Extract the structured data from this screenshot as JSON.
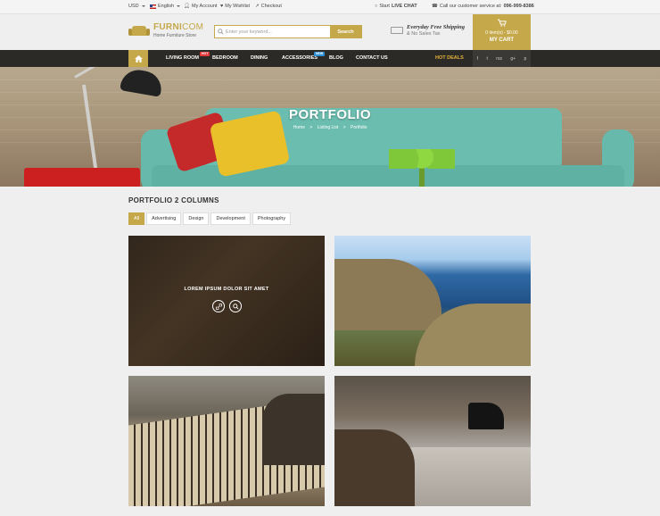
{
  "topbar": {
    "currency": "USD",
    "language": "English",
    "my_account": "My Account",
    "my_wishlist": "My Wishlist",
    "checkout": "Checkout",
    "live_chat_prefix": "Start",
    "live_chat": "LIVE CHAT",
    "call_prefix": "Call our customer service at:",
    "call_number": "096-999-8386"
  },
  "header": {
    "logo_name_a": "FURNI",
    "logo_name_b": "COM",
    "logo_sub": "Home Furniture Store",
    "search_placeholder": "Enter your keyword...",
    "search_button": "Search",
    "shipping_title": "Everyday Free Shipping",
    "shipping_sub": "& No Sales Tax",
    "cart_items": "0 item(s) - $0.00",
    "cart_label": "MY CART"
  },
  "nav": {
    "items": [
      {
        "label": "LIVING ROOM",
        "badge": "HOT"
      },
      {
        "label": "BEDROOM",
        "badge": ""
      },
      {
        "label": "DINING",
        "badge": ""
      },
      {
        "label": "ACCESSORIES",
        "badge": "NEW"
      },
      {
        "label": "BLOG",
        "badge": ""
      },
      {
        "label": "CONTACT US",
        "badge": ""
      }
    ],
    "hot_deals": "HOT DEALS",
    "social": [
      "f",
      "t",
      "rss",
      "g+",
      "p"
    ]
  },
  "banner": {
    "title": "PORTFOLIO",
    "breadcrumb": [
      "Home",
      "Listing List",
      "Portfolio"
    ],
    "separator": ">"
  },
  "portfolio": {
    "title": "PORTFOLIO 2 COLUMNS",
    "filters": [
      "All",
      "Advertising",
      "Design",
      "Development",
      "Photography"
    ],
    "active_filter": "All",
    "hover_title": "LOREM IPSUM DOLOR SIT AMET"
  },
  "colors": {
    "accent": "#c5a84a",
    "nav_bg": "#2b2a27",
    "hot_badge": "#e23a3a",
    "new_badge": "#2f8fd3"
  }
}
